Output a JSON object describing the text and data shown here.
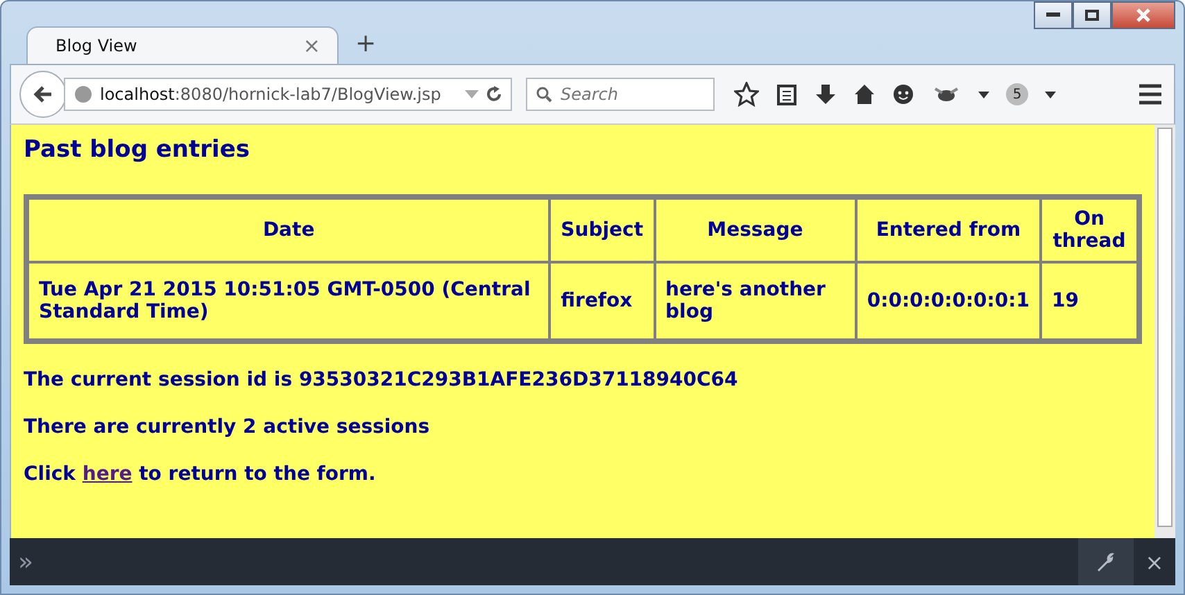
{
  "window": {
    "title": "Blog View",
    "tab_close": "×",
    "new_tab": "+"
  },
  "toolbar": {
    "url_host": "localhost",
    "url_rest": ":8080/hornick-lab7/BlogView.jsp",
    "search_placeholder": "Search",
    "badge": "5"
  },
  "page": {
    "heading": "Past blog entries",
    "table": {
      "columns": [
        "Date",
        "Subject",
        "Message",
        "Entered from",
        "On thread"
      ],
      "rows": [
        [
          "Tue Apr 21 2015 10:51:05 GMT-0500 (Central Standard Time)",
          "firefox",
          "here's another blog",
          "0:0:0:0:0:0:0:1",
          "19"
        ]
      ]
    },
    "session_line": "The current session id is 93530321C293B1AFE236D37118940C64",
    "active_line": "There are currently 2 active sessions",
    "link_line": {
      "before": "Click",
      "link": "here",
      "after": "to return to the form."
    }
  },
  "devtools": {
    "prompt": "»",
    "close": "×"
  }
}
